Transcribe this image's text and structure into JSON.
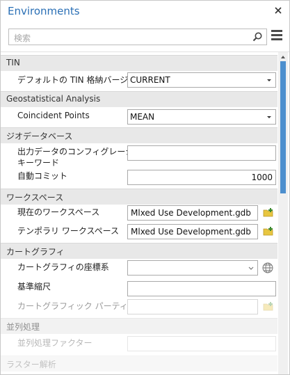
{
  "window": {
    "title": "Environments"
  },
  "search": {
    "placeholder": "検索"
  },
  "sections": {
    "tin": {
      "header": "TIN",
      "tin_version": {
        "label": "デフォルトの TIN 格納バージョン",
        "value": "CURRENT"
      }
    },
    "geostat": {
      "header": "Geostatistical Analysis",
      "coincident_points": {
        "label": "Coincident Points",
        "value": "MEAN"
      }
    },
    "geodatabase": {
      "header": "ジオデータベース",
      "config_keyword": {
        "label_line1": "出力データのコンフィグレーション",
        "label_line2": "キーワード",
        "value": ""
      },
      "auto_commit": {
        "label": "自動コミット",
        "value": "1000"
      }
    },
    "workspace": {
      "header": "ワークスペース",
      "current": {
        "label": "現在のワークスペース",
        "value": "Mlxed Use Development.gdb"
      },
      "scratch": {
        "label": "テンポラリ ワークスペース",
        "value": "Mlxed Use Development.gdb"
      }
    },
    "cartography": {
      "header": "カートグラフィ",
      "coord_system": {
        "label": "カートグラフィの座標系",
        "value": ""
      },
      "reference_scale": {
        "label": "基準縮尺",
        "value": ""
      },
      "partitions": {
        "label": "カートグラフィック パーティション",
        "value": ""
      }
    },
    "parallel": {
      "header": "並列処理",
      "factor": {
        "label": "並列処理ファクター",
        "value": ""
      }
    },
    "raster": {
      "header": "ラスター解析"
    }
  },
  "colors": {
    "title": "#2a6fb5",
    "scroll_thumb": "#4d8fce",
    "folder": "#e8c640",
    "add_plus": "#3c8a2e"
  },
  "icons": {
    "close": "close-icon",
    "search": "search-icon",
    "menu": "hamburger-menu-icon",
    "dropdown": "chevron-down-icon",
    "folder": "folder-add-icon",
    "globe": "globe-icon"
  }
}
